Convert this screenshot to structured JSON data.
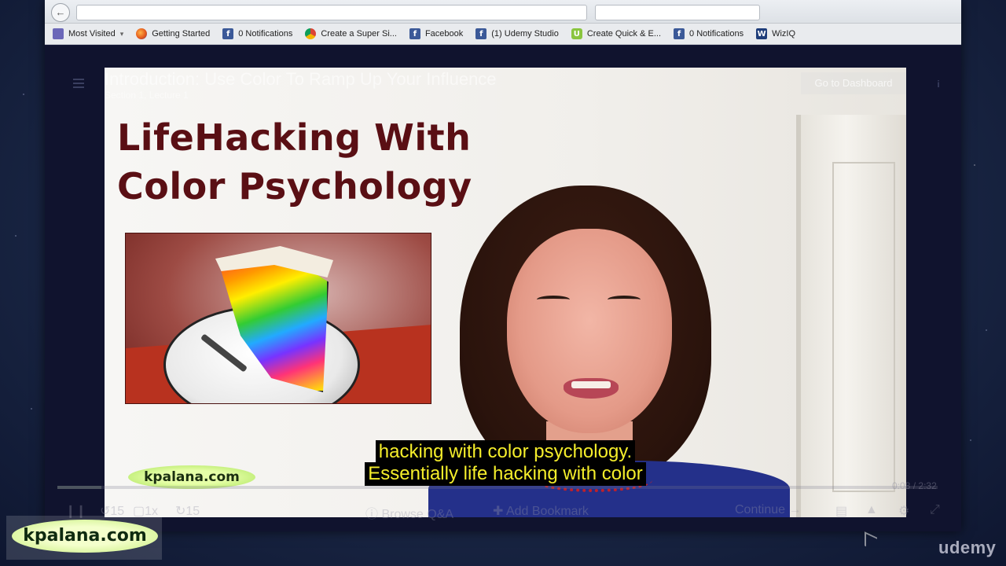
{
  "bookmarks": [
    {
      "label": "Most Visited",
      "icon": "folder-icon",
      "has_caret": true
    },
    {
      "label": "Getting Started",
      "icon": "firefox-icon"
    },
    {
      "label": "0 Notifications",
      "icon": "facebook-icon"
    },
    {
      "label": "Create a Super Si...",
      "icon": "chrome-icon"
    },
    {
      "label": "Facebook",
      "icon": "facebook-icon"
    },
    {
      "label": "(1) Udemy Studio",
      "icon": "facebook-icon"
    },
    {
      "label": "Create Quick & E...",
      "icon": "udemy-icon"
    },
    {
      "label": "0 Notifications",
      "icon": "facebook-icon"
    },
    {
      "label": "WizIQ",
      "icon": "wiziq-icon"
    }
  ],
  "player": {
    "overlay_title": "Introduction: Use Color To Ramp Up Your Influence",
    "overlay_subtitle": "Section 1, Lecture 1",
    "dashboard_button": "Go to Dashboard",
    "slide_title_line1": "LifeHacking With",
    "slide_title_line2": "Color Psychology",
    "slide_logo": "kpalana.com",
    "caption_line1": "hacking with color psychology.",
    "caption_line2": "Essentially life hacking with color",
    "time_current": "0:08",
    "time_separator": "/",
    "time_total": "2:32",
    "progress_fraction": 0.05,
    "speed": "1x",
    "rewind": "15",
    "forward": "15",
    "browse_qa": "Browse Q&A",
    "add_bookmark": "Add Bookmark",
    "continue": "Continue"
  },
  "watermark": {
    "logo_text": "kpalana.com",
    "brand": "udemy"
  },
  "colors": {
    "slide_title": "#5a0f14",
    "caption_text": "#f5ee2b",
    "logo_green": "#a9e25a"
  }
}
